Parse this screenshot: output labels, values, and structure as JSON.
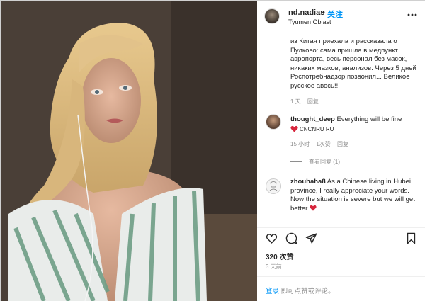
{
  "post": {
    "username": "nd.nadias",
    "separator": "•",
    "follow_label": "关注",
    "location": "Tyumen Oblast"
  },
  "comments": [
    {
      "text": "из Китая приехала и рассказала о Пулково: сама пришла в медпункт аэропорта, весь персонал без масок, никаких мазков, анализов. Через 5 дней Роспотребнадзор позвонил... Великое русское авось!!!",
      "time": "1 天",
      "reply_label": "回复"
    },
    {
      "username": "thought_deep",
      "text": "Everything will be fine",
      "flags_text": "CNCNRU RU",
      "time": "15 小时",
      "likes": "1次赞",
      "reply_label": "回复",
      "view_replies": "查看回复 (1)"
    },
    {
      "username": "zhouhaha8",
      "text": "As a Chinese living in Hubei province, I really appreciate your words. Now the situation is severe but we will get better"
    }
  ],
  "likes_label": "320 次赞",
  "timestamp": "3 天前",
  "login": {
    "link": "登录",
    "rest": " 即可点赞或评论。"
  },
  "icons": {
    "like": "heart-outline-icon",
    "comment": "comment-bubble-icon",
    "share": "paper-plane-icon",
    "save": "bookmark-icon",
    "more": "more-dots-icon"
  },
  "colors": {
    "accent": "#0095f6",
    "heart": "#ed4956",
    "muted": "#8e8e8e"
  }
}
